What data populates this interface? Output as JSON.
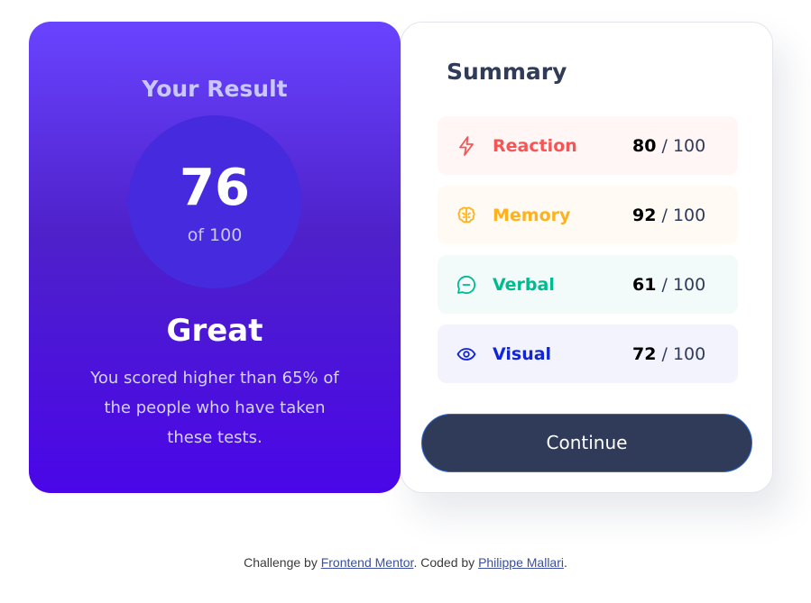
{
  "result": {
    "title": "Your Result",
    "score": "76",
    "of_label": "of 100",
    "rating": "Great",
    "description": "You scored higher than 65% of the people who have taken these tests."
  },
  "summary": {
    "title": "Summary",
    "items": [
      {
        "label": "Reaction",
        "score": "80",
        "max": "/ 100",
        "icon": "lightning-icon",
        "color": "#f55555",
        "bg": "#fff6f5"
      },
      {
        "label": "Memory",
        "score": "92",
        "max": "/ 100",
        "icon": "brain-icon",
        "color": "#ffb21e",
        "bg": "#fffbf4"
      },
      {
        "label": "Verbal",
        "score": "61",
        "max": "/ 100",
        "icon": "chat-icon",
        "color": "#00bb8f",
        "bg": "#f2fbfa"
      },
      {
        "label": "Visual",
        "score": "72",
        "max": "/ 100",
        "icon": "eye-icon",
        "color": "#1125d6",
        "bg": "#f3f3fd"
      }
    ],
    "continue_label": "Continue"
  },
  "footer": {
    "prefix": "Challenge by ",
    "link1": "Frontend Mentor",
    "middle": ". Coded by ",
    "link2": "Philippe Mallari",
    "suffix": "."
  },
  "colors": {
    "primary_gradient_start": "#6943ff",
    "primary_gradient_end": "#4a06e8",
    "button": "#303b5a"
  }
}
